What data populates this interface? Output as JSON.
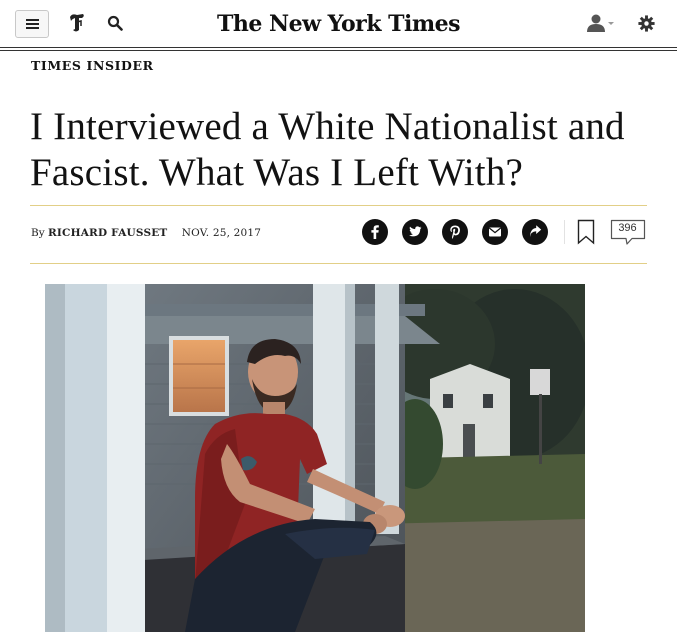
{
  "masthead": {
    "wordmark": "The New York Times",
    "icons": {
      "menu": "hamburger-menu-icon",
      "logo": "nyt-t-logo",
      "search": "search-icon",
      "account": "account-icon",
      "settings": "gear-icon"
    }
  },
  "article": {
    "kicker": "TIMES INSIDER",
    "headline": "I Interviewed a White Nationalist and Fascist. What Was I Left With?",
    "byline": {
      "prefix": "By",
      "author": "RICHARD FAUSSET",
      "date": "NOV. 25, 2017"
    },
    "share_icons": [
      "facebook-icon",
      "twitter-icon",
      "pinterest-icon",
      "email-icon",
      "share-icon"
    ],
    "comment_count": "396"
  },
  "colors": {
    "rule": "#e2cf87",
    "text": "#121212"
  }
}
